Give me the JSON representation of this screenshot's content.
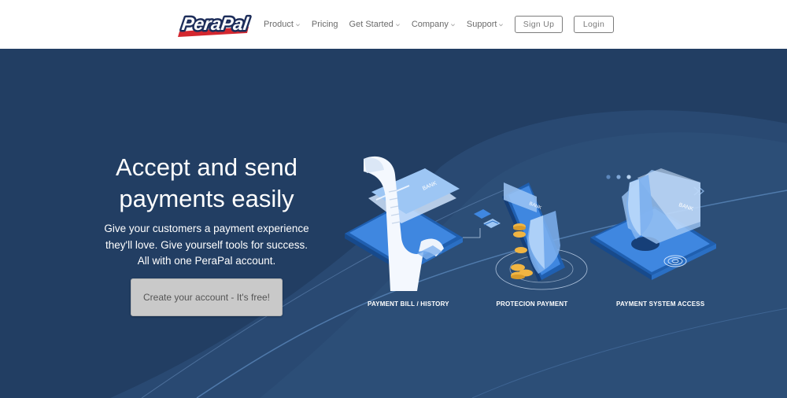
{
  "brand": {
    "logo_text": "PeraPal"
  },
  "nav": {
    "items": [
      {
        "label": "Product",
        "has_dropdown": true
      },
      {
        "label": "Pricing",
        "has_dropdown": false
      },
      {
        "label": "Get Started",
        "has_dropdown": true
      },
      {
        "label": "Company",
        "has_dropdown": true
      },
      {
        "label": "Support",
        "has_dropdown": true
      }
    ],
    "signup_label": "Sign Up",
    "login_label": "Login"
  },
  "hero": {
    "headline_line1": "Accept and send",
    "headline_line2": "payments easily",
    "sub_line1": "Give your customers a payment experience",
    "sub_line2": "they'll love. Give yourself tools for success.",
    "sub_line3": "All with one PeraPal account.",
    "cta_label": "Create your account - It's free!",
    "features": [
      {
        "caption": "PAYMENT BILL / HISTORY",
        "card_text": "BANK"
      },
      {
        "caption": "PROTECION PAYMENT",
        "card_text": "BANK"
      },
      {
        "caption": "PAYMENT SYSTEM ACCESS",
        "card_text": "BANK"
      }
    ]
  },
  "colors": {
    "hero_bg": "#223e63",
    "accent_blue": "#3f87e0",
    "button_gray": "#c9c9c9",
    "logo_red": "#d3272f",
    "logo_navy": "#1d2d5a"
  }
}
